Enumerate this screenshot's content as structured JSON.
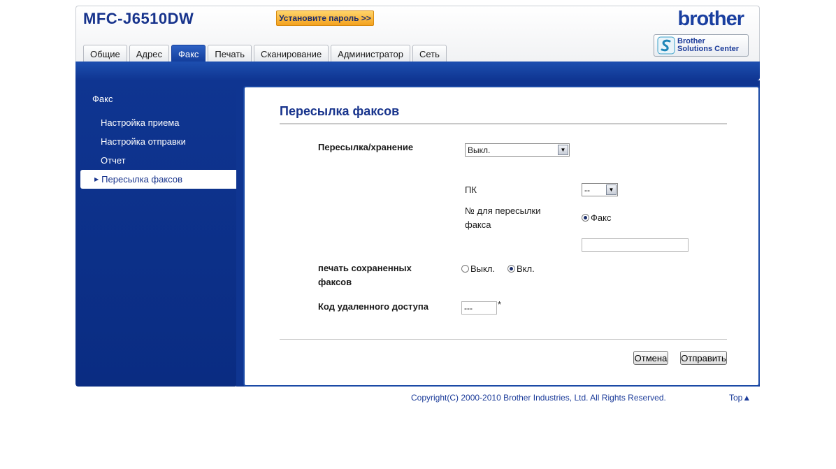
{
  "header": {
    "model": "MFC-J6510DW",
    "set_password_label": "Установите пароль >>",
    "logo": "brother",
    "solutions_center_line1": "Brother",
    "solutions_center_line2": "Solutions Center",
    "brand_color": "#17338c",
    "accent_color": "#f4a21f"
  },
  "tabs": [
    {
      "label": "Общие"
    },
    {
      "label": "Адрес"
    },
    {
      "label": "Факс",
      "active": true
    },
    {
      "label": "Печать"
    },
    {
      "label": "Сканирование"
    },
    {
      "label": "Администратор"
    },
    {
      "label": "Сеть"
    }
  ],
  "sidebar": {
    "title": "Факс",
    "items": [
      {
        "label": "Настройка приема"
      },
      {
        "label": "Настройка отправки"
      },
      {
        "label": "Отчет"
      },
      {
        "label": "Пересылка факсов",
        "active": true
      }
    ]
  },
  "form": {
    "page_title": "Пересылка факсов",
    "forward_storage_label": "Пересылка/хранение",
    "forward_storage_value": "Выкл.",
    "pc_label": "ПК",
    "pc_value": "--",
    "forward_number_label_line1": "№ для пересылки",
    "forward_number_label_line2": "факса",
    "fax_radio_label": "Факс",
    "fax_number_value": "",
    "print_stored_label_line1": "печать сохраненных",
    "print_stored_label_line2": "факсов",
    "print_off_label": "Выкл.",
    "print_on_label": "Вкл.",
    "print_stored_selected": "Вкл.",
    "remote_code_label": "Код удаленного доступа",
    "remote_code_value": "---",
    "remote_code_suffix": "*",
    "cancel_label": "Отмена",
    "submit_label": "Отправить"
  },
  "footer": {
    "copyright": "Copyright(C) 2000-2010 Brother Industries, Ltd. All Rights Reserved.",
    "top_link": "Top",
    "top_arrow": "▲"
  }
}
